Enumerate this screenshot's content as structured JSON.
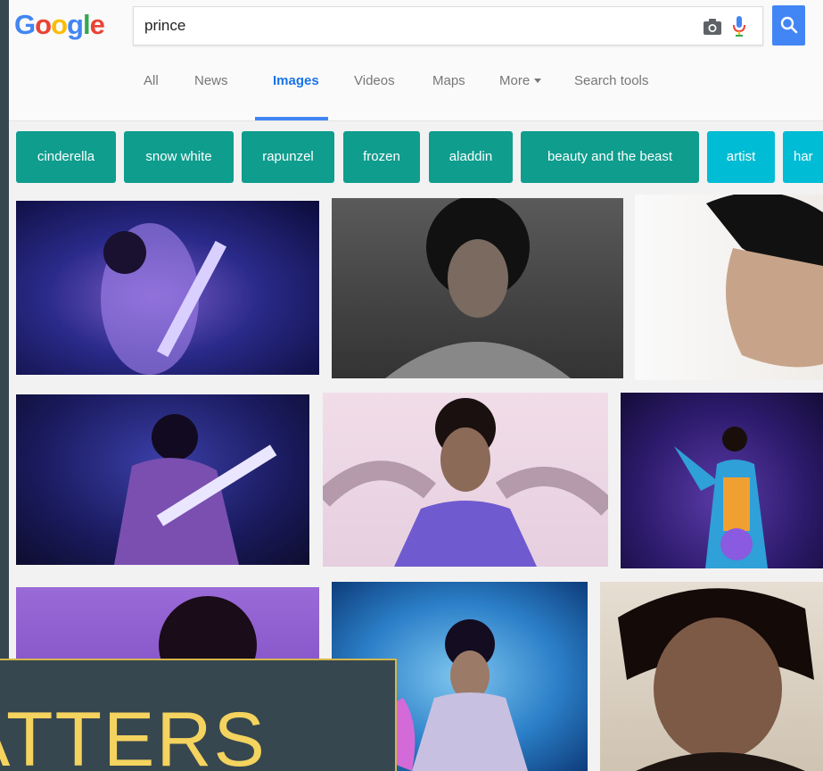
{
  "logo": {
    "letters": [
      "G",
      "o",
      "o",
      "g",
      "l",
      "e"
    ],
    "colors": [
      "#4285f4",
      "#ea4335",
      "#fbbc05",
      "#4285f4",
      "#34a853",
      "#ea4335"
    ]
  },
  "search": {
    "query": "prince",
    "button_color": "#4285f4"
  },
  "tabs": [
    {
      "label": "All",
      "active": false
    },
    {
      "label": "News",
      "active": false
    },
    {
      "label": "Images",
      "active": true
    },
    {
      "label": "Videos",
      "active": false
    },
    {
      "label": "Maps",
      "active": false
    },
    {
      "label": "More",
      "active": false
    },
    {
      "label": "Search tools",
      "active": false
    }
  ],
  "related_chips": [
    {
      "label": "cinderella",
      "color": "#0f9d8e"
    },
    {
      "label": "snow white",
      "color": "#0f9d8e"
    },
    {
      "label": "rapunzel",
      "color": "#0f9d8e"
    },
    {
      "label": "frozen",
      "color": "#0f9d8e"
    },
    {
      "label": "aladdin",
      "color": "#0f9d8e"
    },
    {
      "label": "beauty and the beast",
      "color": "#0f9d8e"
    },
    {
      "label": "artist",
      "color": "#00bcd4"
    },
    {
      "label": "har",
      "color": "#00bcd4"
    }
  ],
  "overlay": {
    "text": "ATTERS",
    "text_color": "#f4d35e",
    "background": "#37474f",
    "border_color": "#d4b64a"
  }
}
